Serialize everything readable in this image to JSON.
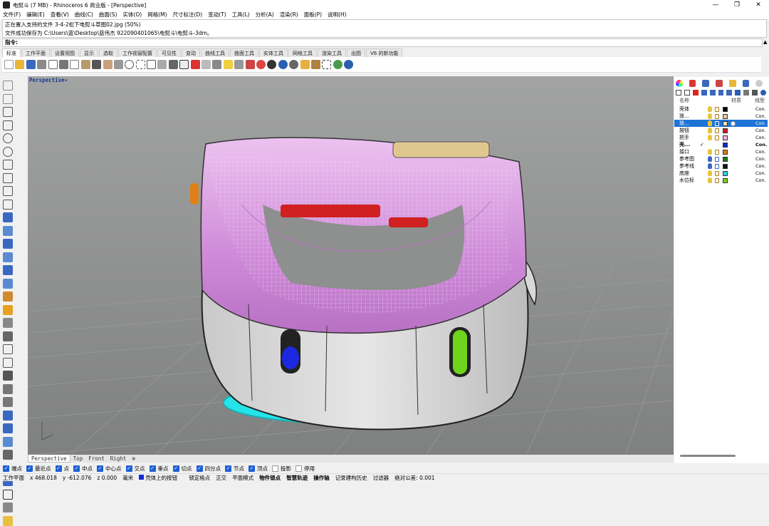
{
  "window": {
    "title": "电熨斗 (7 MB) - Rhinoceros 6 商业版 - [Perspective]",
    "minimize": "—",
    "maximize": "❐",
    "close": "✕"
  },
  "menu": [
    "文件(F)",
    "编辑(E)",
    "查看(V)",
    "曲线(C)",
    "曲面(S)",
    "实体(O)",
    "网格(M)",
    "尺寸标注(D)",
    "变动(T)",
    "工具(L)",
    "分析(A)",
    "渲染(R)",
    "面板(P)",
    "说明(H)"
  ],
  "command_history": [
    "正在置入支持的文件 3-4-2松下电熨斗草图02.jpg (50%)",
    "文件成功保存为 C:\\Users\\蓝\\Desktop\\蓝伟杰 922090401065\\电熨斗\\电熨斗-3dm。"
  ],
  "command_prompt": "指令:",
  "tabs": [
    "标准",
    "工作平面",
    "设置视图",
    "显示",
    "选取",
    "工作视窗配置",
    "可见性",
    "变动",
    "曲线工具",
    "曲面工具",
    "实体工具",
    "网格工具",
    "渲染工具",
    "出图",
    "V6 的新功能"
  ],
  "viewport": {
    "label": "Perspective",
    "dropdown": "▾"
  },
  "view_tabs": [
    "Perspective",
    "Top",
    "Front",
    "Right",
    "⊕"
  ],
  "layers_header": {
    "name": "名称",
    "material": "材质",
    "linetype": "线型"
  },
  "layers": [
    {
      "name": "壳体",
      "color": "#000000",
      "selected": false,
      "linetype": "Con."
    },
    {
      "name": "琐...",
      "color": "#e8c7a0",
      "selected": false,
      "linetype": "Con."
    },
    {
      "name": "琐...",
      "color": "#f4e3a7",
      "selected": true,
      "linetype": "Con."
    },
    {
      "name": "按钮",
      "color": "#d41c1c",
      "selected": false,
      "linetype": "Con."
    },
    {
      "name": "把手",
      "color": "#f4b6d8",
      "selected": false,
      "linetype": "Con."
    },
    {
      "name": "壳...",
      "color": "#1028d8",
      "selected": false,
      "linetype": "Con.",
      "current": "✓"
    },
    {
      "name": "接口",
      "color": "#e07b1a",
      "selected": false,
      "linetype": "Con."
    },
    {
      "name": "参考图",
      "color": "#1a7a1a",
      "selected": false,
      "linetype": "Con."
    },
    {
      "name": "参考线",
      "color": "#111111",
      "selected": false,
      "linetype": "Con."
    },
    {
      "name": "底座",
      "color": "#2ad4e0",
      "selected": false,
      "linetype": "Con."
    },
    {
      "name": "水位标",
      "color": "#7ad41c",
      "selected": false,
      "linetype": "Con."
    }
  ],
  "osnaps": [
    {
      "label": "端点",
      "on": true
    },
    {
      "label": "最近点",
      "on": true
    },
    {
      "label": "点",
      "on": true
    },
    {
      "label": "中点",
      "on": true
    },
    {
      "label": "中心点",
      "on": true
    },
    {
      "label": "交点",
      "on": true
    },
    {
      "label": "垂点",
      "on": true
    },
    {
      "label": "切点",
      "on": true
    },
    {
      "label": "四分点",
      "on": true
    },
    {
      "label": "节点",
      "on": true
    },
    {
      "label": "顶点",
      "on": true
    },
    {
      "label": "投影",
      "on": false
    },
    {
      "label": "停用",
      "on": false
    }
  ],
  "status": {
    "cplane": "工作平面",
    "x": "x 468.018",
    "y": "y -612.076",
    "z": "z 0.000",
    "units": "毫米",
    "layer": "壳体上的按钮",
    "grid_snap": "锁定格点",
    "ortho": "正交",
    "planar": "平面模式",
    "osnap": "物件锁点",
    "smarttrack": "智慧轨迹",
    "gumball": "操作轴",
    "history": "记录建构历史",
    "filter": "过滤器",
    "tolerance": "绝对公差: 0.001"
  }
}
